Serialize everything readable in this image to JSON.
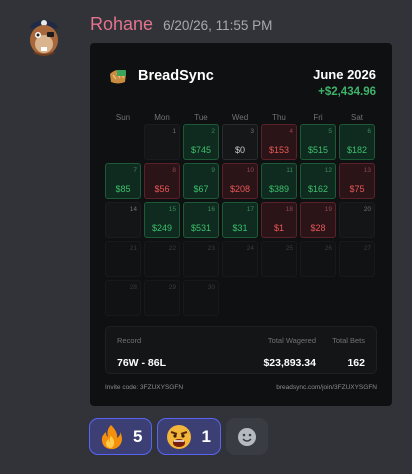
{
  "message": {
    "username": "Rohane",
    "timestamp": "6/20/26, 11:55 PM"
  },
  "card": {
    "brand": "BreadSync",
    "month": "June 2026",
    "month_total": "+$2,434.96",
    "weekdays": [
      "Sun",
      "Mon",
      "Tue",
      "Wed",
      "Thu",
      "Fri",
      "Sat"
    ],
    "days": [
      {
        "day": "",
        "amount": "",
        "status": "empty"
      },
      {
        "day": "1",
        "amount": "",
        "status": "none"
      },
      {
        "day": "2",
        "amount": "$745",
        "status": "win"
      },
      {
        "day": "3",
        "amount": "$0",
        "status": "flat"
      },
      {
        "day": "4",
        "amount": "$153",
        "status": "loss"
      },
      {
        "day": "5",
        "amount": "$515",
        "status": "win"
      },
      {
        "day": "6",
        "amount": "$182",
        "status": "win"
      },
      {
        "day": "7",
        "amount": "$85",
        "status": "win"
      },
      {
        "day": "8",
        "amount": "$56",
        "status": "loss"
      },
      {
        "day": "9",
        "amount": "$67",
        "status": "win"
      },
      {
        "day": "10",
        "amount": "$208",
        "status": "loss"
      },
      {
        "day": "11",
        "amount": "$389",
        "status": "win"
      },
      {
        "day": "12",
        "amount": "$162",
        "status": "win"
      },
      {
        "day": "13",
        "amount": "$75",
        "status": "loss"
      },
      {
        "day": "14",
        "amount": "",
        "status": "none"
      },
      {
        "day": "15",
        "amount": "$249",
        "status": "win"
      },
      {
        "day": "16",
        "amount": "$531",
        "status": "win"
      },
      {
        "day": "17",
        "amount": "$31",
        "status": "win"
      },
      {
        "day": "18",
        "amount": "$1",
        "status": "loss"
      },
      {
        "day": "19",
        "amount": "$28",
        "status": "loss"
      },
      {
        "day": "20",
        "amount": "",
        "status": "none"
      },
      {
        "day": "21",
        "amount": "",
        "status": "future"
      },
      {
        "day": "22",
        "amount": "",
        "status": "future"
      },
      {
        "day": "23",
        "amount": "",
        "status": "future"
      },
      {
        "day": "24",
        "amount": "",
        "status": "future"
      },
      {
        "day": "25",
        "amount": "",
        "status": "future"
      },
      {
        "day": "26",
        "amount": "",
        "status": "future"
      },
      {
        "day": "27",
        "amount": "",
        "status": "future"
      },
      {
        "day": "28",
        "amount": "",
        "status": "future"
      },
      {
        "day": "29",
        "amount": "",
        "status": "future"
      },
      {
        "day": "30",
        "amount": "",
        "status": "future"
      }
    ],
    "stats": {
      "record_label": "Record",
      "record_value": "76W - 86L",
      "wagered_label": "Total Wagered",
      "wagered_value": "$23,893.34",
      "bets_label": "Total Bets",
      "bets_value": "162"
    },
    "invite_code": "Invite code: 3FZUXYSGFN",
    "invite_link": "breadsync.com/join/3FZUXYSGFN",
    "colors": {
      "win": "#3ec06e",
      "loss": "#ea5757",
      "total": "#3fb26b"
    }
  },
  "reactions": [
    {
      "emoji": "fire-emoji",
      "count": "5"
    },
    {
      "emoji": "angry-face-emoji",
      "count": "1"
    }
  ],
  "add_reaction": {
    "icon": "smiley-add-icon"
  }
}
